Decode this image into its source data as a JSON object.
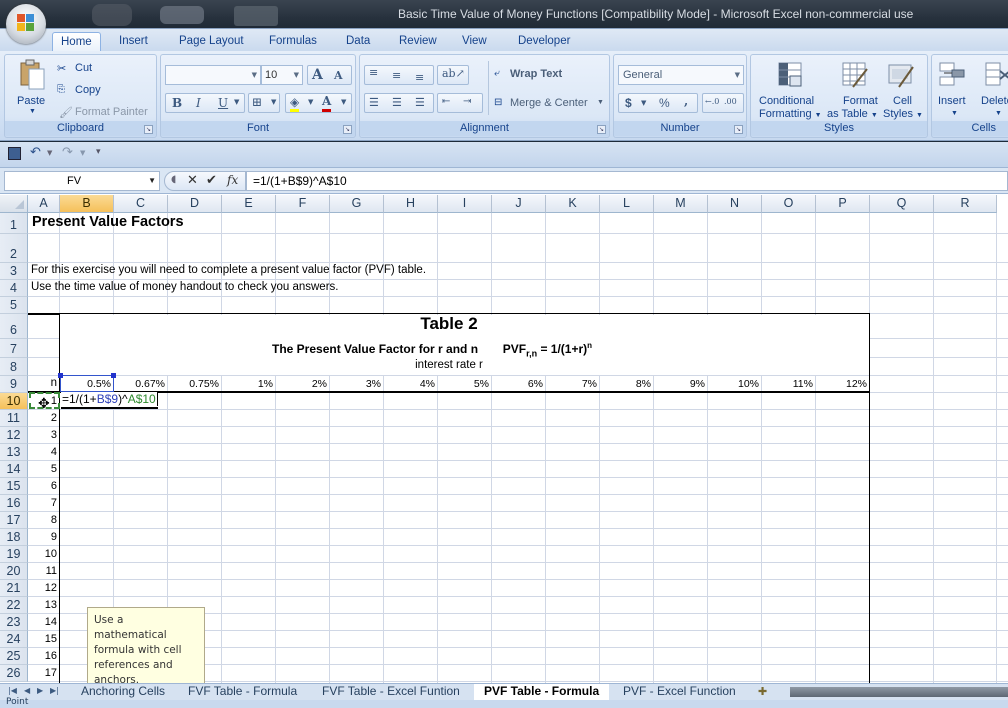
{
  "window": {
    "title": "Basic Time Value of Money Functions  [Compatibility Mode] - Microsoft Excel non-commercial use"
  },
  "ribbon_tabs": [
    {
      "label": "Home",
      "active": true
    },
    {
      "label": "Insert"
    },
    {
      "label": "Page Layout"
    },
    {
      "label": "Formulas"
    },
    {
      "label": "Data"
    },
    {
      "label": "Review"
    },
    {
      "label": "View"
    },
    {
      "label": "Developer"
    }
  ],
  "ribbon": {
    "clipboard": {
      "label": "Clipboard",
      "paste": "Paste",
      "cut": "Cut",
      "copy": "Copy",
      "format_painter": "Format Painter"
    },
    "font": {
      "label": "Font",
      "font_name": "",
      "font_size": "10",
      "bold": "B",
      "italic": "I",
      "underline": "U",
      "grow": "A",
      "shrink": "A"
    },
    "alignment": {
      "label": "Alignment",
      "wrap_text": "Wrap Text",
      "merge_center": "Merge & Center"
    },
    "number": {
      "label": "Number",
      "format": "General",
      "currency": "$",
      "percent": "%",
      "comma": ",",
      "inc_decimal": ".00→.0",
      "dec_decimal": ".00→.0"
    },
    "styles": {
      "label": "Styles",
      "conditional": "Conditional",
      "conditional2": "Formatting",
      "format_table": "Format",
      "format_table2": "as Table",
      "cell_styles": "Cell",
      "cell_styles2": "Styles"
    },
    "cells": {
      "label": "Cells",
      "insert": "Insert",
      "delete": "Delete"
    }
  },
  "formula_bar": {
    "name_box": "FV",
    "formula": "=1/(1+B$9)^A$10"
  },
  "columns": [
    "A",
    "B",
    "C",
    "D",
    "E",
    "F",
    "G",
    "H",
    "I",
    "J",
    "K",
    "L",
    "M",
    "N",
    "O",
    "P",
    "Q",
    "R"
  ],
  "selected_column": "B",
  "rows": [
    "1",
    "2",
    "3",
    "4",
    "5",
    "6",
    "7",
    "8",
    "9",
    "10",
    "11",
    "12",
    "13",
    "14",
    "15",
    "16",
    "17",
    "18",
    "19",
    "20",
    "21",
    "22",
    "23",
    "24",
    "25",
    "26"
  ],
  "selected_row": "10",
  "sheet": {
    "title": "Present Value Factors",
    "line3": "For this exercise you will need to complete a present value factor (PVF) table.",
    "line4": "Use the time value of money handout to check you answers.",
    "table_title": "Table 2",
    "table_subtitle": "The Present Value Factor for r and n",
    "pvf_label": "PVF",
    "pvf_sub": "r,n",
    "pvf_eq": " =  1/(1+r)",
    "pvf_exp": "n",
    "rate_label": "interest rate r",
    "n_label": "n",
    "rates": [
      "0.5%",
      "0.67%",
      "0.75%",
      "1%",
      "2%",
      "3%",
      "4%",
      "5%",
      "6%",
      "7%",
      "8%",
      "9%",
      "10%",
      "11%",
      "12%"
    ],
    "periods": [
      "1",
      "2",
      "3",
      "4",
      "5",
      "6",
      "7",
      "8",
      "9",
      "10",
      "11",
      "12",
      "13",
      "14",
      "15",
      "16",
      "17"
    ],
    "editing_formula": {
      "prefix": "=1/(1+",
      "ref1": "B$9",
      "mid": ")^",
      "ref2": "A$10"
    }
  },
  "tooltip": "Use a mathematical formula with cell references and anchors.",
  "sheet_tabs": [
    {
      "label": "Anchoring Cells"
    },
    {
      "label": "FVF Table - Formula"
    },
    {
      "label": "FVF Table - Excel Funtion"
    },
    {
      "label": "PVF Table - Formula",
      "active": true
    },
    {
      "label": "PVF - Excel Function"
    }
  ],
  "status": {
    "mode": "Point"
  }
}
